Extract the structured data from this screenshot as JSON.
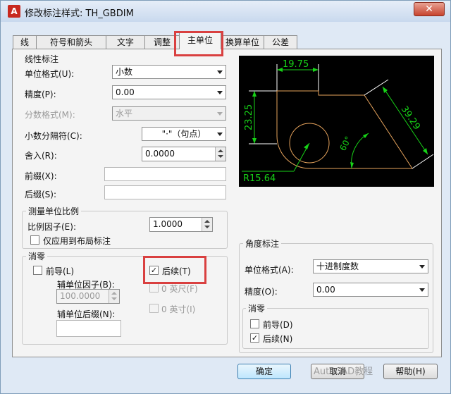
{
  "window": {
    "icon_glyph": "A",
    "title": "修改标注样式: TH_GBDIM",
    "close_glyph": "✕",
    "brand_color": "#c8281e"
  },
  "tabs": [
    {
      "label": "线",
      "active": false
    },
    {
      "label": "符号和箭头",
      "active": false
    },
    {
      "label": "文字",
      "active": false
    },
    {
      "label": "调整",
      "active": false
    },
    {
      "label": "主单位",
      "active": true
    },
    {
      "label": "换算单位",
      "active": false
    },
    {
      "label": "公差",
      "active": false
    }
  ],
  "linear": {
    "group_label": "线性标注",
    "unit_format": {
      "label": "单位格式(U):",
      "value": "小数"
    },
    "precision": {
      "label": "精度(P):",
      "value": "0.00"
    },
    "fraction_format": {
      "label": "分数格式(M):",
      "value": "水平"
    },
    "decimal_separator": {
      "label": "小数分隔符(C):",
      "value": "\"·\"（句点）"
    },
    "round_off": {
      "label": "舍入(R):",
      "value": "0.0000"
    },
    "prefix": {
      "label": "前缀(X):",
      "value": ""
    },
    "suffix": {
      "label": "后缀(S):",
      "value": ""
    }
  },
  "scale": {
    "group_label": "测量单位比例",
    "factor": {
      "label": "比例因子(E):",
      "value": "1.0000"
    },
    "layout_only": {
      "label": "仅应用到布局标注",
      "checked": false
    }
  },
  "zero_suppression": {
    "group_label": "消零",
    "leading": {
      "label": "前导(L)",
      "checked": false
    },
    "sub_unit_factor": {
      "label": "辅单位因子(B):",
      "value": "100.0000"
    },
    "sub_unit_suffix": {
      "label": "辅单位后缀(N):",
      "value": ""
    },
    "trailing": {
      "label": "后续(T)",
      "checked": true
    },
    "zero_feet": {
      "label": "0 英尺(F)",
      "checked": false
    },
    "zero_inches": {
      "label": "0 英寸(I)",
      "checked": false
    }
  },
  "preview": {
    "dim_top": "19.75",
    "dim_left": "23.25",
    "dim_right": "39.29",
    "dim_angle": "60°",
    "dim_radius": "R15.64"
  },
  "angular": {
    "group_label": "角度标注",
    "unit_format": {
      "label": "单位格式(A):",
      "value": "十进制度数"
    },
    "precision": {
      "label": "精度(O):",
      "value": "0.00"
    },
    "zero_group_label": "消零",
    "leading": {
      "label": "前导(D)",
      "checked": false
    },
    "trailing": {
      "label": "后续(N)",
      "checked": true
    }
  },
  "buttons": {
    "ok": "确定",
    "cancel": "取消",
    "help": "帮助(H)"
  },
  "watermark": "AutoCAD教程",
  "colors": {
    "highlight": "#d94040",
    "preview_line": "#ffffff",
    "preview_dim": "#17d217",
    "preview_shape": "#e6a35c"
  }
}
